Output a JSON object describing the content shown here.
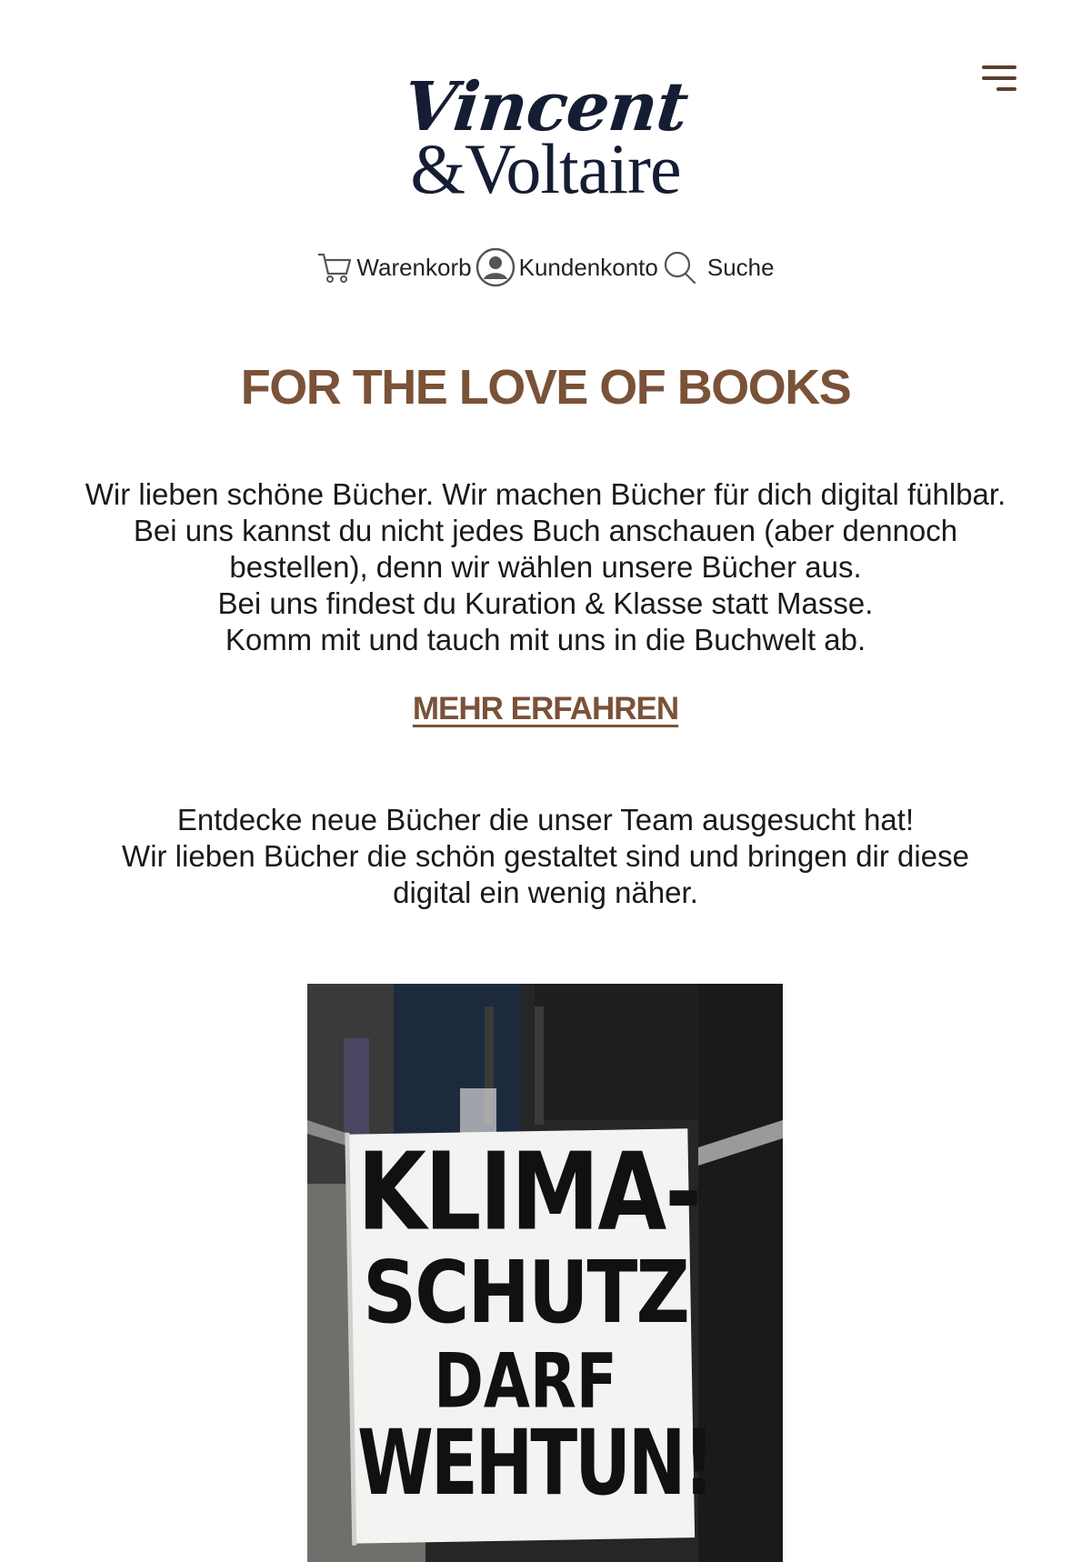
{
  "header": {
    "logo_line1": "Vincent",
    "logo_line2": "&Voltaire",
    "menu_icon": "hamburger-menu-icon"
  },
  "nav": {
    "cart": {
      "label": "Warenkorb",
      "icon": "cart-icon"
    },
    "account": {
      "label": "Kundenkonto",
      "icon": "user-icon"
    },
    "search": {
      "label": "Suche",
      "icon": "search-icon"
    }
  },
  "hero": {
    "headline": "FOR THE LOVE OF BOOKS",
    "intro_lines": [
      "Wir lieben schöne Bücher. Wir machen Bücher für dich digital fühlbar. Bei uns kannst du nicht jedes Buch anschauen (aber dennoch bestellen), denn wir wählen unsere Bücher aus.",
      "Bei uns findest du Kuration & Klasse statt Masse.",
      "Komm mit und tauch mit uns in die Buchwelt ab."
    ],
    "cta": "MEHR ERFAHREN"
  },
  "discover": {
    "lines": [
      "Entdecke neue Bücher die unser Team ausgesucht hat!",
      "Wir lieben Bücher die schön gestaltet sind und bringen dir diese digital ein wenig näher."
    ]
  },
  "book_image": {
    "sign_lines": [
      "KLIMA-",
      "SCHUTZ",
      "DARF",
      "WEHTUN!"
    ]
  },
  "colors": {
    "accent": "#7a5238",
    "logo": "#141d33",
    "text": "#1a1a1a"
  }
}
